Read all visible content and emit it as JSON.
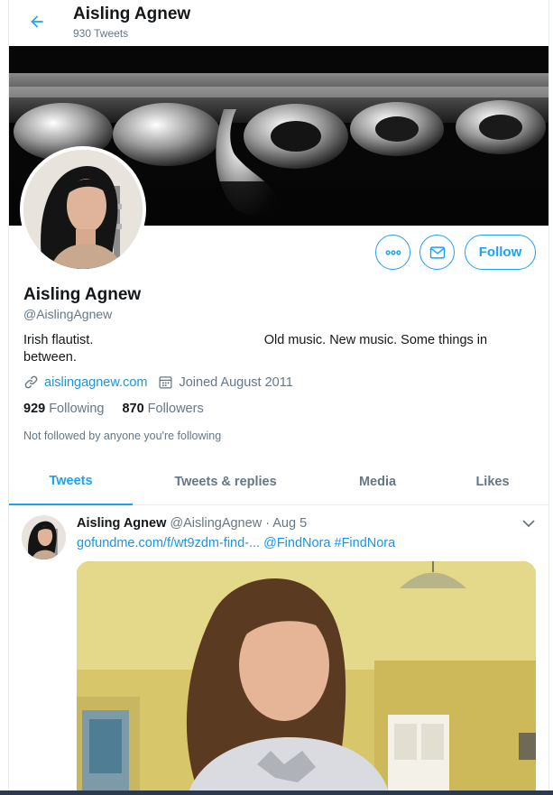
{
  "header": {
    "name": "Aisling Agnew",
    "tweet_count": "930 Tweets",
    "back_icon": "arrow-left-icon"
  },
  "profile": {
    "name": "Aisling Agnew",
    "handle": "@AislingAgnew",
    "bio": "Irish flautist.                                               Old music. New music. Some things in\nbetween.",
    "website": "aislingagnew.com",
    "joined": "Joined August 2011",
    "following_count": "929",
    "following_label": "Following",
    "followers_count": "870",
    "followers_label": "Followers",
    "not_followed": "Not followed by anyone you're following",
    "follow_label": "Follow"
  },
  "tabs": [
    {
      "label": "Tweets"
    },
    {
      "label": "Tweets & replies"
    },
    {
      "label": "Media"
    },
    {
      "label": "Likes"
    }
  ],
  "tweet": {
    "name": "Aisling Agnew",
    "handle_date": "@AislingAgnew · Aug 5",
    "link": "gofundme.com/f/wt9zdm-find-...",
    "mention": "@FindNora",
    "hashtag": "#FindNora"
  },
  "colors": {
    "accent": "#1da1f2",
    "link": "#1b95e0",
    "secondary_text": "#657786"
  }
}
